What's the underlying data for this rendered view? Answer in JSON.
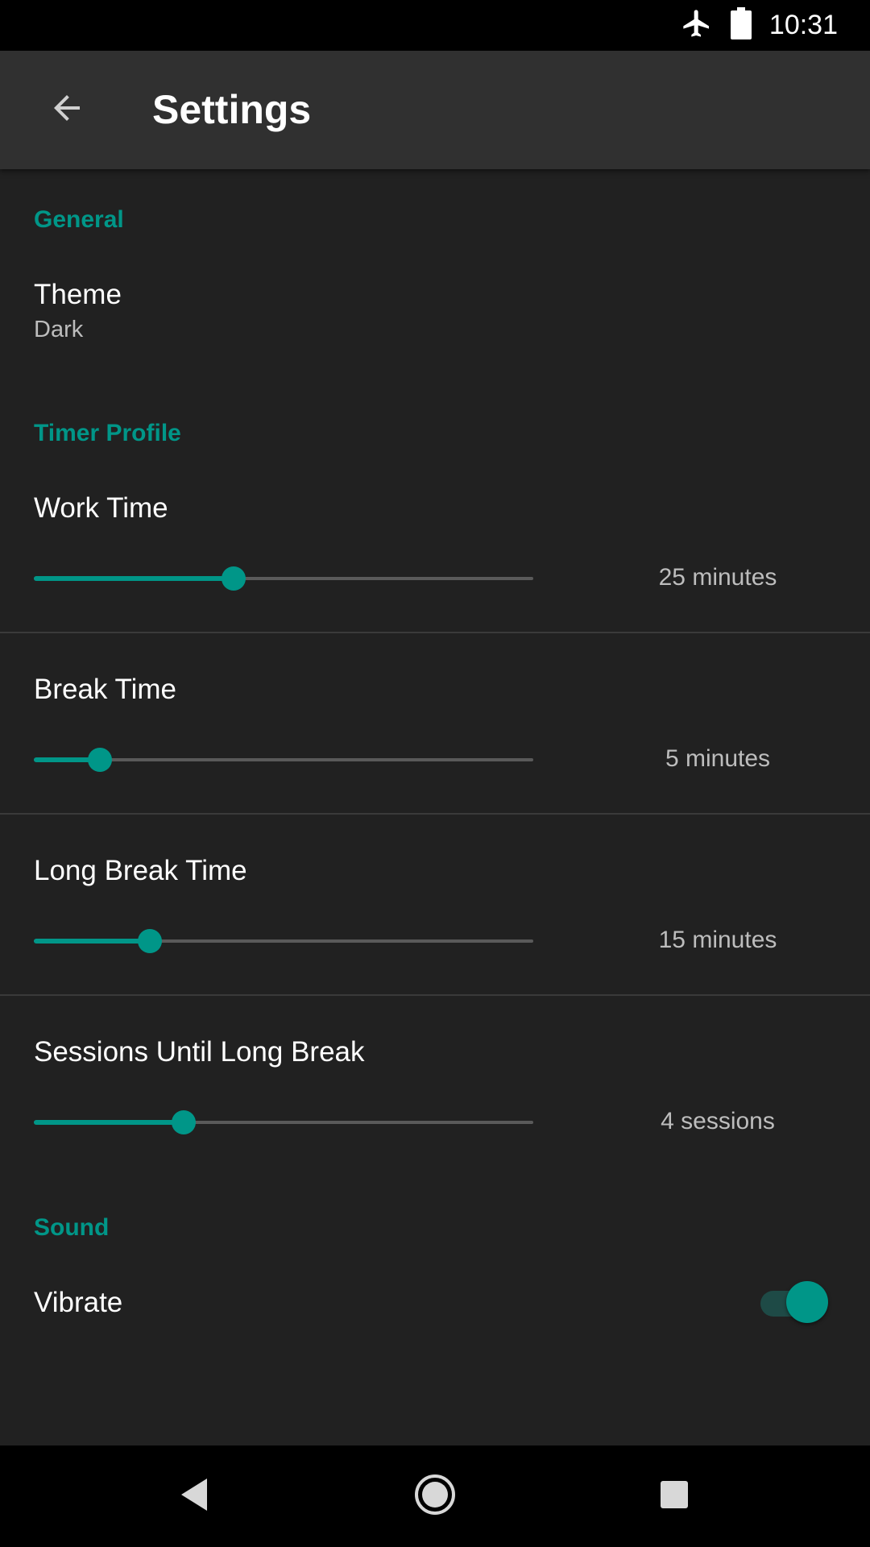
{
  "status_bar": {
    "time": "10:31",
    "icons": [
      "airplane-mode-icon",
      "battery-icon"
    ]
  },
  "toolbar": {
    "title": "Settings",
    "back_icon": "arrow-back-icon"
  },
  "sections": {
    "general": {
      "header": "General",
      "theme": {
        "title": "Theme",
        "summary": "Dark"
      }
    },
    "timer_profile": {
      "header": "Timer Profile",
      "work_time": {
        "title": "Work Time",
        "value": "25 minutes",
        "level": 0.4
      },
      "break_time": {
        "title": "Break Time",
        "value": "5 minutes",
        "level": 0.133
      },
      "long_break_time": {
        "title": "Long Break Time",
        "value": "15 minutes",
        "level": 0.233
      },
      "sessions_until_long_break": {
        "title": "Sessions Until Long Break",
        "value": "4 sessions",
        "level": 0.3
      }
    },
    "sound": {
      "header": "Sound",
      "vibrate": {
        "title": "Vibrate",
        "enabled": true
      }
    }
  },
  "colors": {
    "accent": "#009688",
    "background": "#212121",
    "toolbar": "#303030"
  },
  "nav_bar": {
    "icons": [
      "nav-back-icon",
      "nav-home-icon",
      "nav-recents-icon"
    ]
  }
}
